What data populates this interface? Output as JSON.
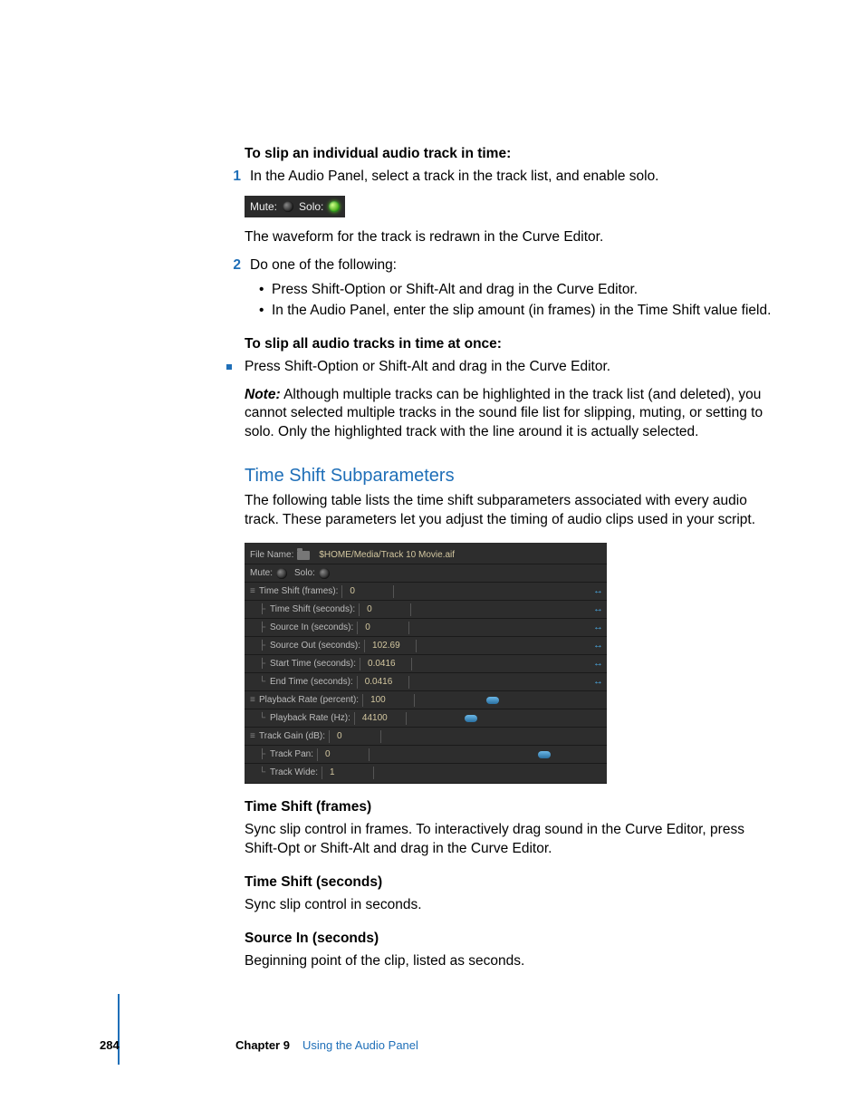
{
  "section1": {
    "heading": "To slip an individual audio track in time:",
    "step1": "In the Audio Panel, select a track in the track list, and enable solo.",
    "muteLabel": "Mute:",
    "soloLabel": "Solo:",
    "afterImage": "The waveform for the track is redrawn in the Curve Editor.",
    "step2": "Do one of the following:",
    "b1": "Press Shift-Option or Shift-Alt and drag in the Curve Editor.",
    "b2": "In the Audio Panel, enter the slip amount (in frames) in the Time Shift value field."
  },
  "section2": {
    "heading": "To slip all audio tracks in time at once:",
    "bullet": "Press Shift-Option or Shift-Alt and drag in the Curve Editor.",
    "noteLabel": "Note:",
    "noteBody": "Although multiple tracks can be highlighted in the track list (and deleted), you cannot selected multiple tracks in the sound file list for slipping, muting, or setting to solo. Only the highlighted track with the line around it is actually selected."
  },
  "h2": "Time Shift Subparameters",
  "intro": "The following table lists the time shift subparameters associated with every audio track. These parameters let you adjust the timing of audio clips used in your script.",
  "panel": {
    "fileNameLabel": "File Name:",
    "fileName": "$HOME/Media/Track 10 Movie.aif",
    "muteLabel": "Mute:",
    "soloLabel": "Solo:",
    "rows": [
      {
        "label": "Time Shift (frames):",
        "value": "0",
        "arrows": true
      },
      {
        "label": "Time Shift (seconds):",
        "value": "0",
        "arrows": true
      },
      {
        "label": "Source In (seconds):",
        "value": "0",
        "arrows": true
      },
      {
        "label": "Source Out (seconds):",
        "value": "102.69",
        "arrows": true
      },
      {
        "label": "Start Time (seconds):",
        "value": "0.0416",
        "arrows": true
      },
      {
        "label": "End Time (seconds):",
        "value": "0.0416",
        "arrows": true
      },
      {
        "label": "Playback Rate (percent):",
        "value": "100",
        "slider": 40
      },
      {
        "label": "Playback Rate (Hz):",
        "value": "44100",
        "slider": 30
      },
      {
        "label": "Track Gain (dB):",
        "value": "0"
      },
      {
        "label": "Track Pan:",
        "value": "0",
        "slider": 78
      },
      {
        "label": "Track Wide:",
        "value": "1"
      }
    ]
  },
  "defs": [
    {
      "term": "Time Shift (frames)",
      "body": "Sync slip control in frames. To interactively drag sound in the Curve Editor, press Shift-Opt or Shift-Alt and drag in the Curve Editor."
    },
    {
      "term": "Time Shift (seconds)",
      "body": "Sync slip control in seconds."
    },
    {
      "term": "Source In (seconds)",
      "body": "Beginning point of the clip, listed as seconds."
    }
  ],
  "footer": {
    "page": "284",
    "chapter": "Chapter 9",
    "title": "Using the Audio Panel"
  }
}
